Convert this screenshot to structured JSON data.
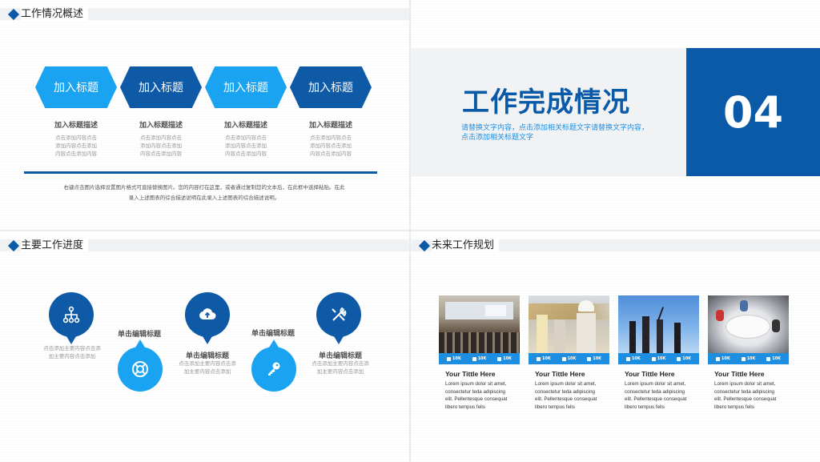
{
  "slide1": {
    "section_title": "工作情况概述",
    "columns": [
      {
        "hex": "加入标题",
        "heading": "加入标题描述",
        "body": [
          "点击添加内容点击",
          "添加内容点击添加",
          "内容点击添加内容"
        ]
      },
      {
        "hex": "加入标题",
        "heading": "加入标题描述",
        "body": [
          "点击添加内容点击",
          "添加内容点击添加",
          "内容点击添加内容"
        ]
      },
      {
        "hex": "加入标题",
        "heading": "加入标题描述",
        "body": [
          "点击添加内容点击",
          "添加内容点击添加",
          "内容点击添加内容"
        ]
      },
      {
        "hex": "加入标题",
        "heading": "加入标题描述",
        "body": [
          "点击添加内容点击",
          "添加内容点击添加",
          "内容点击添加内容"
        ]
      }
    ],
    "paragraph": [
      "右键点击图片选择设置图片格式可直接替换图片。您的内容打在这里，或者通过复制您的文本后，在此框中选择粘贴。在此",
      "录入上述图表的综合描述说明在此录入上述图表的综合描述说明。"
    ]
  },
  "slide2": {
    "title": "工作完成情况",
    "subtitle": "请替换文字内容，点击添加相关标题文字请替换文字内容，点击添加相关标题文字",
    "number": "04"
  },
  "slide3": {
    "section_title": "主要工作进度",
    "items": [
      {
        "icon": "network-icon",
        "label": "",
        "text": [
          "点击添加主要内容点击添",
          "加主要内容点击添加"
        ]
      },
      {
        "icon": "lifebuoy-icon",
        "label": "单击编辑标题",
        "text": []
      },
      {
        "icon": "cloud-upload-icon",
        "label": "单击编辑标题",
        "text": [
          "点击添加主要内容点击添",
          "加主要内容点击添加"
        ]
      },
      {
        "icon": "key-icon",
        "label": "单击编辑标题",
        "text": []
      },
      {
        "icon": "tools-icon",
        "label": "单击编辑标题",
        "text": [
          "点击添加主要内容点击添",
          "加主要内容点击添加"
        ]
      }
    ]
  },
  "slide4": {
    "section_title": "未来工作规划",
    "social": [
      "10K",
      "10K",
      "10K"
    ],
    "cards": [
      {
        "title": "Your Tittle Here",
        "body": [
          "Lorem ipsum dolor sit amet,",
          "consectetur teda adipiscing",
          "elit. Pellentesque consequat",
          "libero tempus felis"
        ]
      },
      {
        "title": "Your Tittle Here",
        "body": [
          "Lorem ipsum dolor sit amet,",
          "consectetur teda adipiscing",
          "elit. Pellentesque consequat",
          "libero tempus felis"
        ]
      },
      {
        "title": "Your Tittle Here",
        "body": [
          "Lorem ipsum dolor sit amet,",
          "consectetur teda adipiscing",
          "elit. Pellentesque consequat",
          "libero tempus felis"
        ]
      },
      {
        "title": "Your Tittle Here",
        "body": [
          "Lorem ipsum dolor sit amet,",
          "consectetur teda adipiscing",
          "elit. Pellentesque consequat",
          "libero tempus felis"
        ]
      }
    ]
  },
  "colors": {
    "dark_blue": "#0e5aa7",
    "light_blue": "#1aa3f0",
    "accent": "#0a5aa8"
  }
}
